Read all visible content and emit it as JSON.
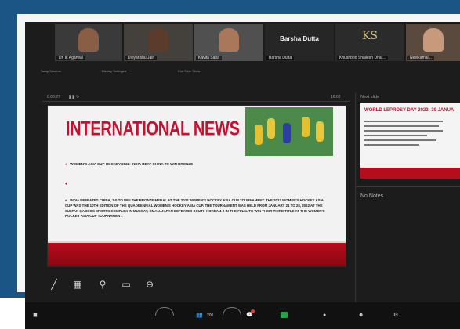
{
  "gallery": {
    "tiles": [
      {
        "name": "Dr. Ik Agarwal",
        "type": "video"
      },
      {
        "name": "Dibyanshu Jain",
        "type": "video"
      },
      {
        "name": "Kavita Saha",
        "type": "video"
      },
      {
        "name": "Barsha Dutta",
        "display": "Barsha Dutta",
        "type": "name"
      },
      {
        "name": "Khushboo Shailesh Dhar...",
        "display": "KS",
        "type": "logo"
      },
      {
        "name": "Neelkamal...",
        "type": "video"
      }
    ]
  },
  "controls": {
    "items": [
      "Swap Screens",
      "Display Settings ▾",
      "End Slide Show"
    ]
  },
  "presenter": {
    "elapsed": "0:00:27",
    "clock": "16:02",
    "next_label": "Next slide",
    "notes_label": "No Notes"
  },
  "slide": {
    "title": "INTERNATIONAL NEWS",
    "bullet1": "WOMEN'S ASIA CUP HOCKEY 2022: INDIA BEAT CHINA TO WIN BRONZE",
    "bullet3": "INDIA DEFEATED CHINA, 2-0 TO WIN THE BRONZE MEDAL AT THE 2022 WOMEN'S HOCKEY ASIA CUP TOURNAMENT. THE 2022 WOMEN'S HOCKEY ASIA CUP WAS THE 10TH EDITION OF THE QUADRENNIAL WOMEN'S HOCKEY ASIA CUP. THE TOURNAMENT WAS HELD FROM JANUARY 21 TO 28, 2022 AT THE SULTAN QABOOS SPORTS COMPLEX IN MUSCAT, OMAN. JAPAN DEFEATED SOUTH KOREA 4-2 IN THE FINAL TO WIN THEIR THIRD TITLE AT THE WOMEN'S HOCKEY ASIA CUP TOURNAMENT."
  },
  "next_slide": {
    "title": "WORLD LEPROSY DAY 2022: 30 JANUA"
  },
  "toolbar": {
    "participants_count": "200"
  },
  "colors": {
    "accent_red": "#c8102e",
    "frame_blue": "#1b5586",
    "app_bg": "#1c1c1c"
  }
}
